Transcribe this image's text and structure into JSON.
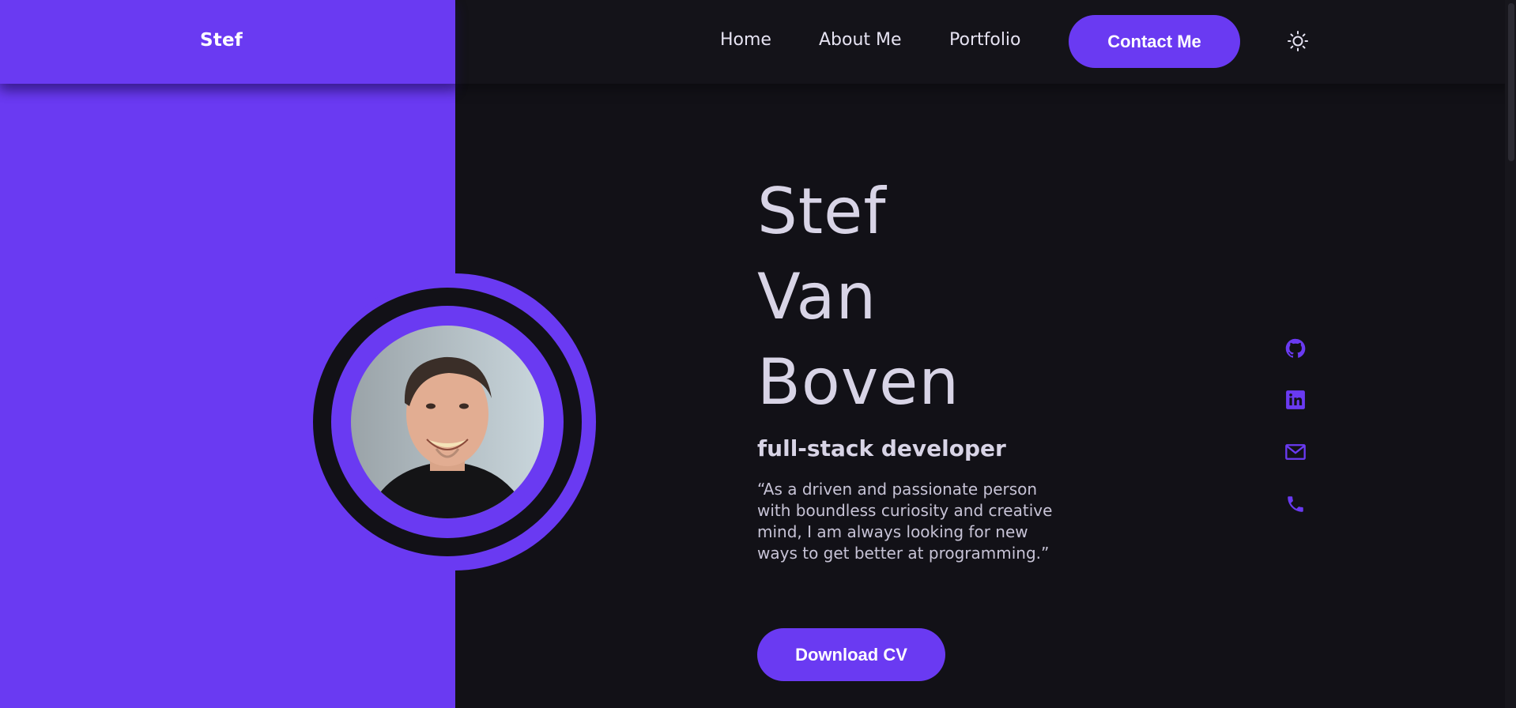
{
  "header": {
    "brand": "Stef",
    "nav": {
      "home": "Home",
      "about": "About Me",
      "portfolio": "Portfolio"
    },
    "contact_button": "Contact Me",
    "theme_icon": "sun-icon"
  },
  "hero": {
    "name_lines": [
      "Stef",
      "Van",
      "Boven"
    ],
    "role": "full-stack developer",
    "quote": "“As a driven and passionate person with boundless curiosity and creative mind, I am always looking for new ways to get better at programming.”",
    "download_button": "Download CV"
  },
  "social": {
    "icons": [
      "github-icon",
      "linkedin-icon",
      "mail-icon",
      "phone-icon"
    ]
  },
  "colors": {
    "accent": "#6a3af2",
    "background": "#121117",
    "text": "#d8d4e6"
  }
}
